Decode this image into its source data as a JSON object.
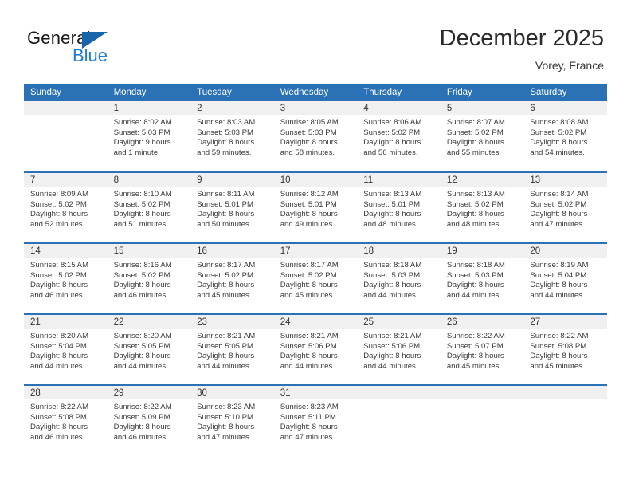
{
  "brand": {
    "name_part1": "General",
    "name_part2": "Blue"
  },
  "header": {
    "title": "December 2025",
    "location": "Vorey, France"
  },
  "calendar": {
    "weekday_headers": [
      "Sunday",
      "Monday",
      "Tuesday",
      "Wednesday",
      "Thursday",
      "Friday",
      "Saturday"
    ],
    "accent_color": "#2a72b5",
    "band_color": "#f0f0f0",
    "weeks": [
      [
        {
          "day": "",
          "lines": []
        },
        {
          "day": "1",
          "lines": [
            "Sunrise: 8:02 AM",
            "Sunset: 5:03 PM",
            "Daylight: 9 hours",
            "and 1 minute."
          ]
        },
        {
          "day": "2",
          "lines": [
            "Sunrise: 8:03 AM",
            "Sunset: 5:03 PM",
            "Daylight: 8 hours",
            "and 59 minutes."
          ]
        },
        {
          "day": "3",
          "lines": [
            "Sunrise: 8:05 AM",
            "Sunset: 5:03 PM",
            "Daylight: 8 hours",
            "and 58 minutes."
          ]
        },
        {
          "day": "4",
          "lines": [
            "Sunrise: 8:06 AM",
            "Sunset: 5:02 PM",
            "Daylight: 8 hours",
            "and 56 minutes."
          ]
        },
        {
          "day": "5",
          "lines": [
            "Sunrise: 8:07 AM",
            "Sunset: 5:02 PM",
            "Daylight: 8 hours",
            "and 55 minutes."
          ]
        },
        {
          "day": "6",
          "lines": [
            "Sunrise: 8:08 AM",
            "Sunset: 5:02 PM",
            "Daylight: 8 hours",
            "and 54 minutes."
          ]
        }
      ],
      [
        {
          "day": "7",
          "lines": [
            "Sunrise: 8:09 AM",
            "Sunset: 5:02 PM",
            "Daylight: 8 hours",
            "and 52 minutes."
          ]
        },
        {
          "day": "8",
          "lines": [
            "Sunrise: 8:10 AM",
            "Sunset: 5:02 PM",
            "Daylight: 8 hours",
            "and 51 minutes."
          ]
        },
        {
          "day": "9",
          "lines": [
            "Sunrise: 8:11 AM",
            "Sunset: 5:01 PM",
            "Daylight: 8 hours",
            "and 50 minutes."
          ]
        },
        {
          "day": "10",
          "lines": [
            "Sunrise: 8:12 AM",
            "Sunset: 5:01 PM",
            "Daylight: 8 hours",
            "and 49 minutes."
          ]
        },
        {
          "day": "11",
          "lines": [
            "Sunrise: 8:13 AM",
            "Sunset: 5:01 PM",
            "Daylight: 8 hours",
            "and 48 minutes."
          ]
        },
        {
          "day": "12",
          "lines": [
            "Sunrise: 8:13 AM",
            "Sunset: 5:02 PM",
            "Daylight: 8 hours",
            "and 48 minutes."
          ]
        },
        {
          "day": "13",
          "lines": [
            "Sunrise: 8:14 AM",
            "Sunset: 5:02 PM",
            "Daylight: 8 hours",
            "and 47 minutes."
          ]
        }
      ],
      [
        {
          "day": "14",
          "lines": [
            "Sunrise: 8:15 AM",
            "Sunset: 5:02 PM",
            "Daylight: 8 hours",
            "and 46 minutes."
          ]
        },
        {
          "day": "15",
          "lines": [
            "Sunrise: 8:16 AM",
            "Sunset: 5:02 PM",
            "Daylight: 8 hours",
            "and 46 minutes."
          ]
        },
        {
          "day": "16",
          "lines": [
            "Sunrise: 8:17 AM",
            "Sunset: 5:02 PM",
            "Daylight: 8 hours",
            "and 45 minutes."
          ]
        },
        {
          "day": "17",
          "lines": [
            "Sunrise: 8:17 AM",
            "Sunset: 5:02 PM",
            "Daylight: 8 hours",
            "and 45 minutes."
          ]
        },
        {
          "day": "18",
          "lines": [
            "Sunrise: 8:18 AM",
            "Sunset: 5:03 PM",
            "Daylight: 8 hours",
            "and 44 minutes."
          ]
        },
        {
          "day": "19",
          "lines": [
            "Sunrise: 8:18 AM",
            "Sunset: 5:03 PM",
            "Daylight: 8 hours",
            "and 44 minutes."
          ]
        },
        {
          "day": "20",
          "lines": [
            "Sunrise: 8:19 AM",
            "Sunset: 5:04 PM",
            "Daylight: 8 hours",
            "and 44 minutes."
          ]
        }
      ],
      [
        {
          "day": "21",
          "lines": [
            "Sunrise: 8:20 AM",
            "Sunset: 5:04 PM",
            "Daylight: 8 hours",
            "and 44 minutes."
          ]
        },
        {
          "day": "22",
          "lines": [
            "Sunrise: 8:20 AM",
            "Sunset: 5:05 PM",
            "Daylight: 8 hours",
            "and 44 minutes."
          ]
        },
        {
          "day": "23",
          "lines": [
            "Sunrise: 8:21 AM",
            "Sunset: 5:05 PM",
            "Daylight: 8 hours",
            "and 44 minutes."
          ]
        },
        {
          "day": "24",
          "lines": [
            "Sunrise: 8:21 AM",
            "Sunset: 5:06 PM",
            "Daylight: 8 hours",
            "and 44 minutes."
          ]
        },
        {
          "day": "25",
          "lines": [
            "Sunrise: 8:21 AM",
            "Sunset: 5:06 PM",
            "Daylight: 8 hours",
            "and 44 minutes."
          ]
        },
        {
          "day": "26",
          "lines": [
            "Sunrise: 8:22 AM",
            "Sunset: 5:07 PM",
            "Daylight: 8 hours",
            "and 45 minutes."
          ]
        },
        {
          "day": "27",
          "lines": [
            "Sunrise: 8:22 AM",
            "Sunset: 5:08 PM",
            "Daylight: 8 hours",
            "and 45 minutes."
          ]
        }
      ],
      [
        {
          "day": "28",
          "lines": [
            "Sunrise: 8:22 AM",
            "Sunset: 5:08 PM",
            "Daylight: 8 hours",
            "and 46 minutes."
          ]
        },
        {
          "day": "29",
          "lines": [
            "Sunrise: 8:22 AM",
            "Sunset: 5:09 PM",
            "Daylight: 8 hours",
            "and 46 minutes."
          ]
        },
        {
          "day": "30",
          "lines": [
            "Sunrise: 8:23 AM",
            "Sunset: 5:10 PM",
            "Daylight: 8 hours",
            "and 47 minutes."
          ]
        },
        {
          "day": "31",
          "lines": [
            "Sunrise: 8:23 AM",
            "Sunset: 5:11 PM",
            "Daylight: 8 hours",
            "and 47 minutes."
          ]
        },
        {
          "day": "",
          "lines": []
        },
        {
          "day": "",
          "lines": []
        },
        {
          "day": "",
          "lines": []
        }
      ]
    ]
  }
}
